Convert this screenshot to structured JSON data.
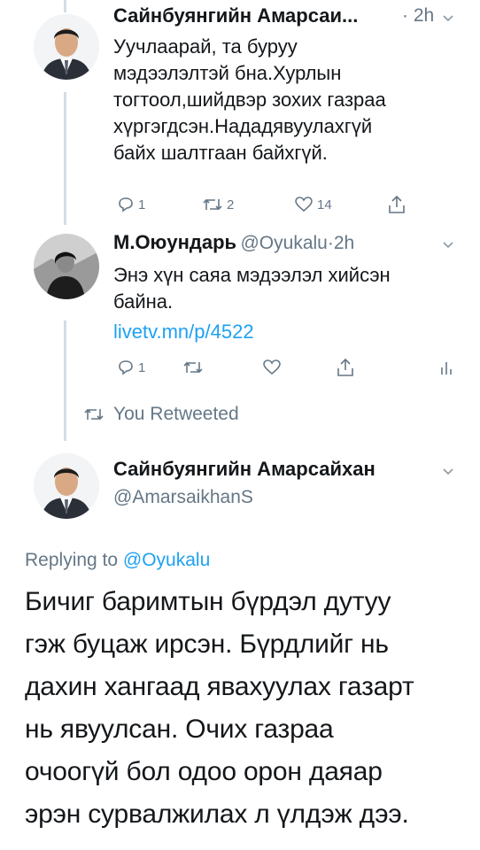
{
  "tweet1": {
    "name": "Сайнбуянгийн Амарсаи...",
    "sep": "·",
    "time": "2h",
    "text_lines": [
      "Уучлаарай, та буруу",
      "мэдээлэлтэй бна.Хурлын",
      "тогтоол,шийдвэр зохих газраа",
      "хүргэгдсэн.Нададявуулахгүй",
      "байх шалтгаан байхгүй."
    ],
    "replies": "1",
    "retweets": "2",
    "likes": "14"
  },
  "tweet2": {
    "name": "М.Оюундарь",
    "handle": "@Oyukalu",
    "sep": "·",
    "time": "2h",
    "text_lines": [
      "Энэ хүн саяа мэдээлэл хийсэн",
      "байна."
    ],
    "link": "livetv.mn/p/4522",
    "replies": "1"
  },
  "retweet_notice": "You Retweeted",
  "main_tweet": {
    "name": "Сайнбуянгийн Амарсайхан",
    "handle": "@AmarsaikhanS",
    "replying_prefix": "Replying to",
    "replying_handle": "@Oyukalu",
    "text_lines": [
      "Бичиг баримтын бүрдэл дутуу",
      "гэж буцаж ирсэн. Бүрдлийг нь",
      "дахин хангаад явахуулах газарт",
      "нь явуулсан. Очих газраа",
      "очоогүй бол одоо орон даяар",
      "эрэн сурвалжилах л үлдэж дээ."
    ]
  },
  "colors": {
    "accent": "#1da1f2",
    "muted": "#657786",
    "thread": "#d3dde5"
  },
  "icons": [
    "reply-icon",
    "retweet-icon",
    "like-icon",
    "share-icon",
    "analytics-icon",
    "chevron-down-icon"
  ]
}
